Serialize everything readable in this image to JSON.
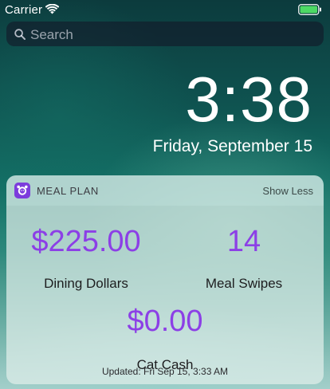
{
  "status_bar": {
    "carrier": "Carrier",
    "wifi_icon": "wifi-icon",
    "battery_icon": "battery-icon"
  },
  "search": {
    "placeholder": "Search",
    "icon": "search-icon"
  },
  "lock_screen": {
    "time": "3:38",
    "date": "Friday, September 15"
  },
  "widget": {
    "app_name": "MEAL PLAN",
    "app_icon": "meal-plan-app-icon",
    "show_less_label": "Show Less",
    "stats": [
      {
        "value": "$225.00",
        "label": "Dining Dollars"
      },
      {
        "value": "14",
        "label": "Meal Swipes"
      },
      {
        "value": "$0.00",
        "label": "Cat Cash"
      }
    ],
    "updated": "Updated: Fri Sep 15, 3:33 AM"
  },
  "colors": {
    "value_purple": "#8c3fe6",
    "app_icon_purple": "#7c3cdc",
    "battery_green": "#4cd964"
  }
}
